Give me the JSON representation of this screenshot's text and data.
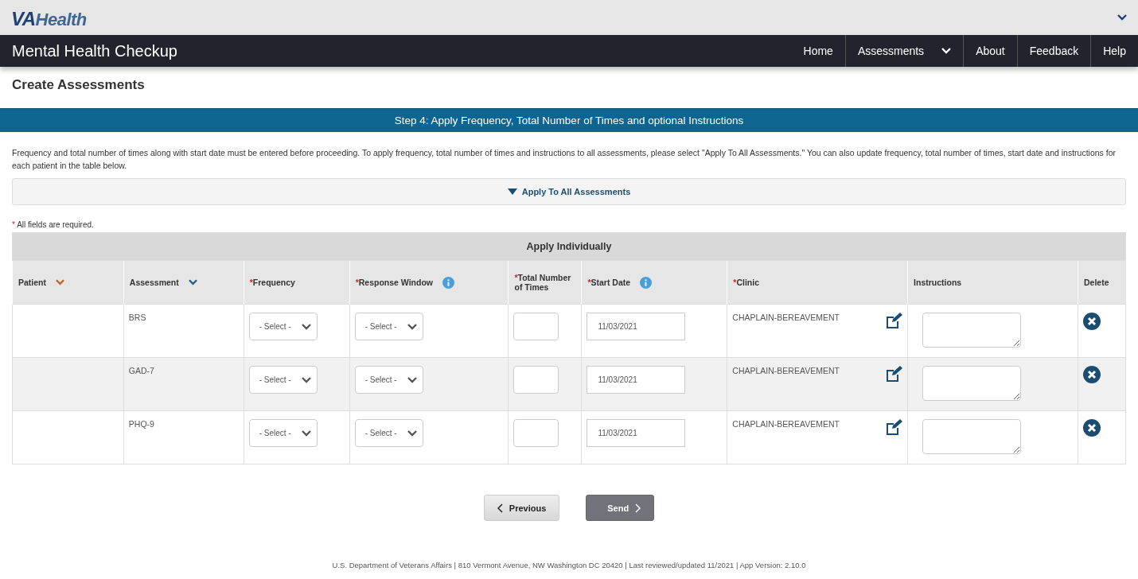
{
  "logo": {
    "strong": "VA",
    "light": "Health"
  },
  "app_title": "Mental Health Checkup",
  "nav": [
    {
      "label": "Home",
      "has_menu": false
    },
    {
      "label": "Assessments",
      "has_menu": true
    },
    {
      "label": "About",
      "has_menu": false
    },
    {
      "label": "Feedback",
      "has_menu": false
    },
    {
      "label": "Help",
      "has_menu": false
    }
  ],
  "page_title": "Create Assessments",
  "step_banner": "Step 4: Apply Frequency, Total Number of Times and optional Instructions",
  "intro": "Frequency and total number of times along with start date must be entered before proceeding. To apply frequency, total number of times and instructions to all assessments, please select \"Apply To All Assessments.\" You can also update frequency, total number of times, start date and instructions for each patient in the table below.",
  "apply_all": {
    "label": "Apply To All Assessments",
    "expanded": false
  },
  "required_note": {
    "mark": "*",
    "text": "All fields are required."
  },
  "table": {
    "title": "Apply Individually",
    "columns": [
      {
        "label": "Patient",
        "required": false,
        "kind": "sort",
        "color": "#c0632a"
      },
      {
        "label": "Assessment",
        "required": false,
        "kind": "sort",
        "color": "#1f5f8b"
      },
      {
        "label": "Frequency",
        "required": true,
        "kind": "plain"
      },
      {
        "label": "Response Window",
        "required": true,
        "kind": "info"
      },
      {
        "label": "Total Number of Times",
        "required": true,
        "kind": "plain"
      },
      {
        "label": "Start Date",
        "required": true,
        "kind": "info"
      },
      {
        "label": "Clinic",
        "required": true,
        "kind": "plain"
      },
      {
        "label": "Instructions",
        "required": false,
        "kind": "plain"
      },
      {
        "label": "Delete",
        "required": false,
        "kind": "plain"
      }
    ],
    "required_mark": "*",
    "rows": [
      {
        "assessment": "BRS",
        "frequency": "- Select -",
        "response_window": "- Select -",
        "start_date": "11/03/2021",
        "clinic": "CHAPLAIN-BEREAVEMENT"
      },
      {
        "assessment": "GAD-7",
        "frequency": "- Select -",
        "response_window": "- Select -",
        "start_date": "11/03/2021",
        "clinic": "CHAPLAIN-BEREAVEMENT"
      },
      {
        "assessment": "PHQ-9",
        "frequency": "- Select -",
        "response_window": "- Select -",
        "start_date": "11/03/2021",
        "clinic": "CHAPLAIN-BEREAVEMENT"
      }
    ]
  },
  "buttons": [
    {
      "label": "Previous",
      "kind": "previous"
    },
    {
      "label": "Send",
      "kind": "send"
    }
  ],
  "footer": "U.S. Department of Veterans Affairs | 810 Vermont Avenue, NW Washington DC 20420 | Last reviewed/updated 11/2021 | App Version: 2.10.0"
}
